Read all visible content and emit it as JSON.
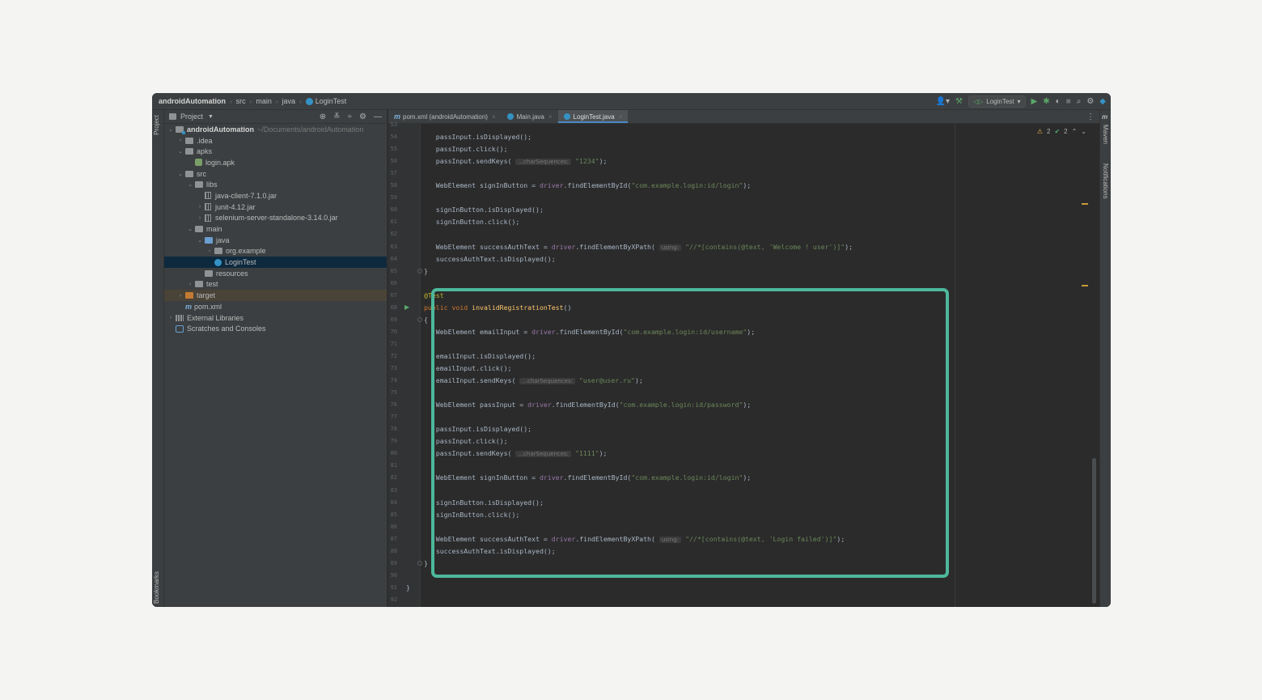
{
  "breadcrumb": [
    "androidAutomation",
    "src",
    "main",
    "java",
    "LoginTest"
  ],
  "toolbar": {
    "run_config": "LoginTest"
  },
  "stripes": {
    "project": "Project",
    "bookmarks": "Bookmarks",
    "maven": "Maven",
    "notifications": "Notifications"
  },
  "project_panel": {
    "title": "Project",
    "tree": [
      {
        "label": "androidAutomation",
        "hint": "~/Documents/androidAutomation"
      },
      {
        "label": ".idea"
      },
      {
        "label": "apks"
      },
      {
        "label": "login.apk"
      },
      {
        "label": "src"
      },
      {
        "label": "libs"
      },
      {
        "label": "java-client-7.1.0.jar"
      },
      {
        "label": "junit-4.12.jar"
      },
      {
        "label": "selenium-server-standalone-3.14.0.jar"
      },
      {
        "label": "main"
      },
      {
        "label": "java"
      },
      {
        "label": "org.example"
      },
      {
        "label": "LoginTest"
      },
      {
        "label": "resources"
      },
      {
        "label": "test"
      },
      {
        "label": "target"
      },
      {
        "label": "pom.xml"
      },
      {
        "label": "External Libraries"
      },
      {
        "label": "Scratches and Consoles"
      }
    ]
  },
  "tabs": [
    {
      "label": "pom.xml (androidAutomation)"
    },
    {
      "label": "Main.java"
    },
    {
      "label": "LoginTest.java"
    }
  ],
  "inspections": {
    "warnings": "2",
    "weak_warnings": "2"
  },
  "code": {
    "line_numbers": [
      "53",
      "54",
      "55",
      "56",
      "57",
      "58",
      "59",
      "60",
      "61",
      "62",
      "63",
      "64",
      "65",
      "66",
      "67",
      "68",
      "69",
      "70",
      "71",
      "72",
      "73",
      "74",
      "75",
      "76",
      "77",
      "78",
      "79",
      "80",
      "81",
      "82",
      "83",
      "84",
      "85",
      "86",
      "87",
      "88",
      "89",
      "90",
      "91",
      "92"
    ],
    "hints": {
      "char_sequences": "...charSequences:",
      "using": "using:"
    },
    "strings": {
      "pass1": "\"1234\"",
      "login_id": "\"com.example.login:id/login\"",
      "xpath_welcome": "\"//*[contains(@text, 'Welcome ! user')]\"",
      "username_id": "\"com.example.login:id/username\"",
      "email": "\"user@user.ru\"",
      "password_id": "\"com.example.login:id/password\"",
      "pass2": "\"1111\"",
      "xpath_failed": "\"//*[contains(@text, 'Login failed')]\""
    }
  }
}
